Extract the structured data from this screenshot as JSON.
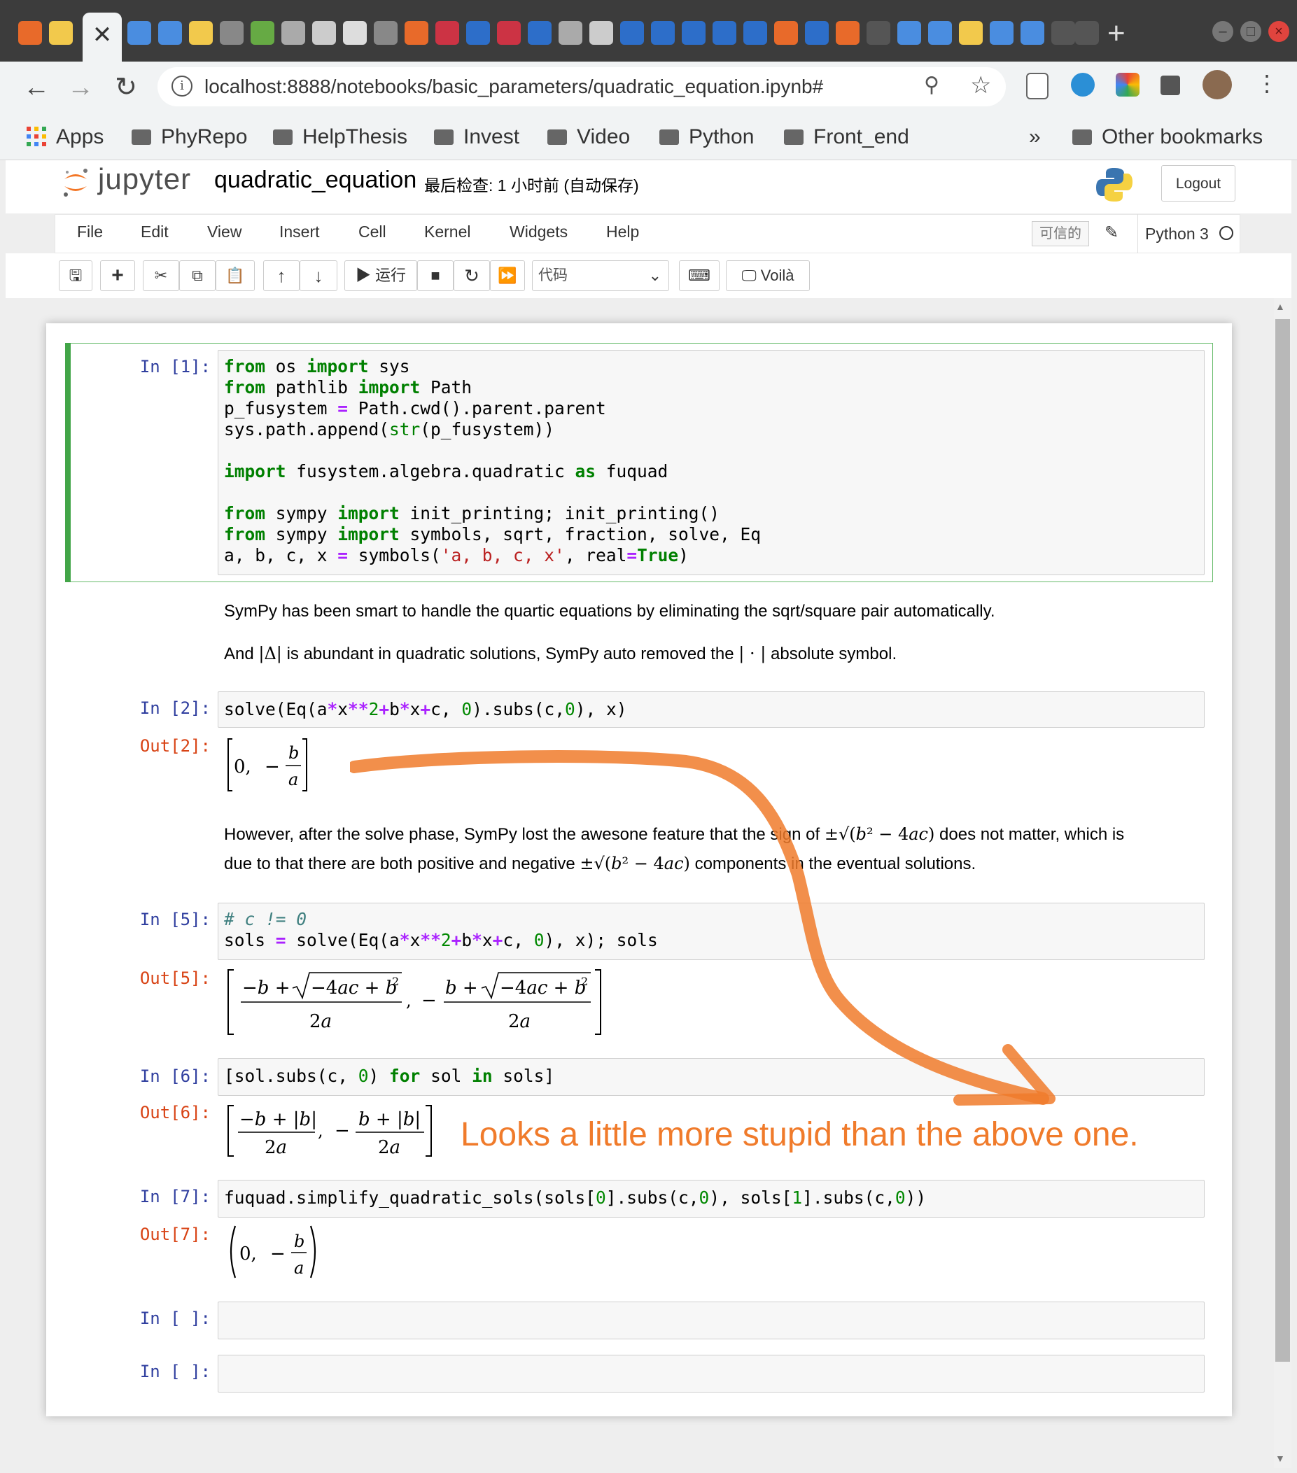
{
  "browser": {
    "address_url": "localhost:8888/notebooks/basic_parameters/quadratic_equation.ipynb#",
    "bookmarks": [
      "Apps",
      "PhyRepo",
      "HelpThesis",
      "Invest",
      "Video",
      "Python",
      "Front_end"
    ],
    "overflow_label": "»",
    "other_bookmarks": "Other bookmarks",
    "new_tab_label": "+",
    "close_tab_label": "✕"
  },
  "jupyter": {
    "logo_text": "jupyter",
    "notebook_name": "quadratic_equation",
    "checkpoint": "最后检查: 1 小时前  (自动保存)",
    "logout_label": "Logout",
    "menus": [
      "File",
      "Edit",
      "View",
      "Insert",
      "Cell",
      "Kernel",
      "Widgets",
      "Help"
    ],
    "trusted_label": "可信的",
    "kernel_name": "Python 3",
    "toolbar": {
      "run_label": "运行",
      "cell_type": "代码",
      "voila_label": "Voilà"
    }
  },
  "cells": {
    "c1_prompt": "In [1]:",
    "md1": {
      "line1": "SymPy has been smart to handle the quartic equations by eliminating the sqrt/square pair automatically.",
      "line2_a": "And",
      "line2_sym": "|Δ|",
      "line2_b": "is abundant in quadratic solutions, SymPy auto removed the",
      "line2_sym2": "| · |",
      "line2_c": "absolute symbol."
    },
    "c2_prompt": "In [2]:",
    "o2_prompt": "Out[2]:",
    "md2": {
      "line1_a": "However, after the solve phase, SymPy lost the awesone feature that the sign of",
      "line1_b": "does not matter, which is",
      "line2_a": "due to that there are both positive and negative",
      "line2_b": "components in the eventual solutions."
    },
    "c5_prompt": "In [5]:",
    "o5_prompt": "Out[5]:",
    "c6_prompt": "In [6]:",
    "o6_prompt": "Out[6]:",
    "c7_prompt": "In [7]:",
    "o7_prompt": "Out[7]:",
    "c8_prompt": "In [ ]:",
    "c9_prompt": "In [ ]:"
  },
  "annotation": {
    "text": "Looks a little more stupid than the above one.",
    "color": "#f07b2b"
  },
  "colors": {
    "prompt_in": "#303f9f",
    "prompt_out": "#d84315",
    "selected_cell": "#42a548"
  }
}
